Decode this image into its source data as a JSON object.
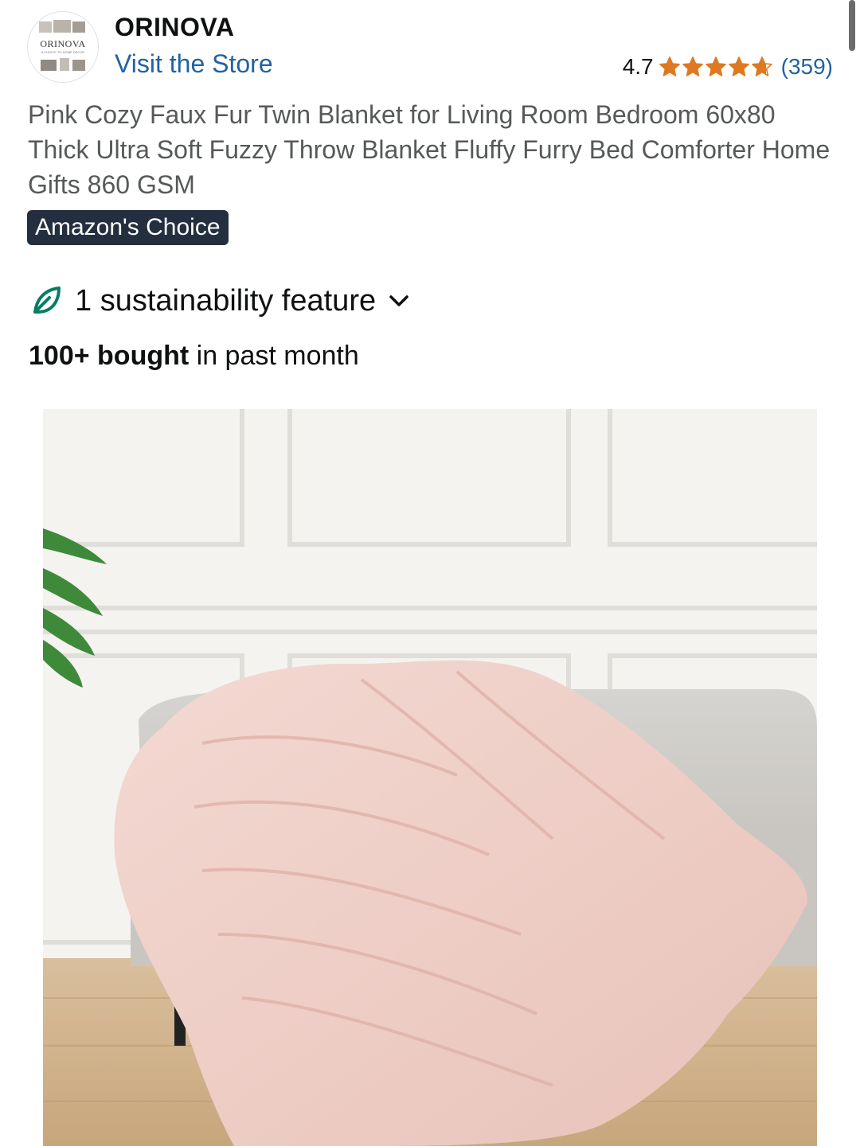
{
  "store": {
    "logo_text": "ORINOVA",
    "logo_subtext": "A CHOICE TO HOME DECOR",
    "name": "ORINOVA",
    "visit_label": "Visit the Store"
  },
  "rating": {
    "value": "4.7",
    "stars": 4.7,
    "count_label": "(359)",
    "star_color": "#de7921"
  },
  "product": {
    "title": "Pink Cozy Faux Fur Twin Blanket for Living Room Bedroom 60x80 Thick Ultra Soft Fuzzy Throw Blanket Fluffy Furry Bed Comforter Home Gifts 860 GSM",
    "badge": "Amazon's Choice"
  },
  "sustainability": {
    "label": "1 sustainability feature",
    "icon": "leaf-icon",
    "expand_icon": "chevron-down-icon"
  },
  "purchases": {
    "count_bold": "100+ bought",
    "rest": " in past month"
  },
  "colors": {
    "link": "#2162a1",
    "badge_bg": "#232f3e",
    "leaf": "#067d62"
  }
}
